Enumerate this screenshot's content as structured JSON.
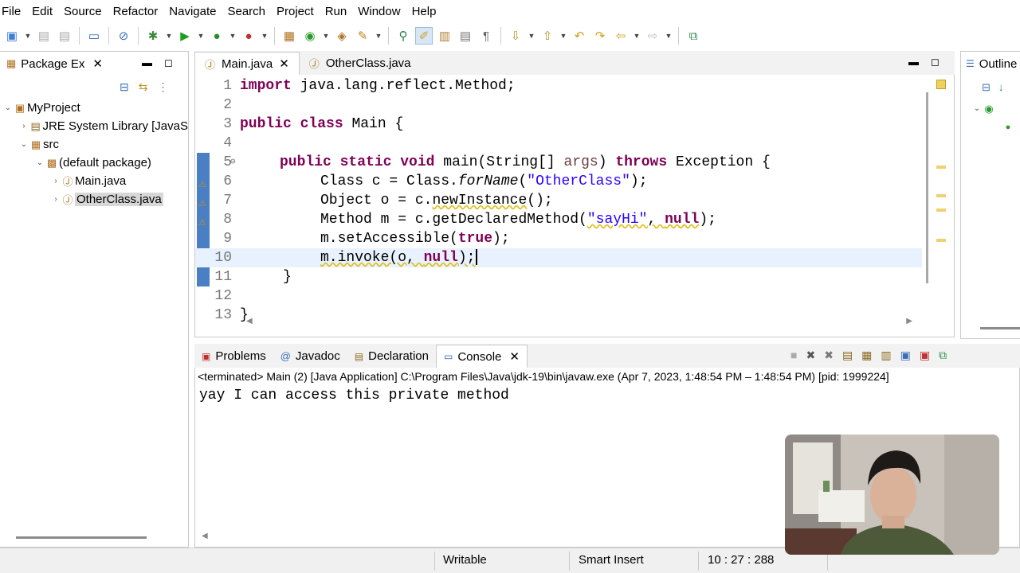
{
  "menu": [
    "File",
    "Edit",
    "Source",
    "Refactor",
    "Navigate",
    "Search",
    "Project",
    "Run",
    "Window",
    "Help"
  ],
  "package_explorer": {
    "title": "Package Ex",
    "tree": [
      {
        "label": "MyProject",
        "level": 0,
        "expanded": true,
        "icon": "project-icon"
      },
      {
        "label": "JRE System Library [JavaS",
        "level": 1,
        "expanded": false,
        "icon": "library-icon"
      },
      {
        "label": "src",
        "level": 1,
        "expanded": true,
        "icon": "source-folder-icon"
      },
      {
        "label": "(default package)",
        "level": 2,
        "expanded": true,
        "icon": "package-icon"
      },
      {
        "label": "Main.java",
        "level": 3,
        "expanded": false,
        "icon": "java-file-icon"
      },
      {
        "label": "OtherClass.java",
        "level": 3,
        "expanded": false,
        "icon": "java-file-icon",
        "selected": true
      }
    ]
  },
  "editor": {
    "tabs": [
      {
        "label": "Main.java",
        "active": true
      },
      {
        "label": "OtherClass.java",
        "active": false
      }
    ],
    "line_numbers": [
      "1",
      "2",
      "3",
      "4",
      "5",
      "6",
      "7",
      "8",
      "9",
      "10",
      "11",
      "12",
      "13"
    ],
    "code": {
      "l1_kw": "import",
      "l1_rest": " java.lang.reflect.Method;",
      "l3_kw1": "public",
      "l3_kw2": "class",
      "l3_rest": " Main {",
      "l5_kw1": "public",
      "l5_kw2": "static",
      "l5_kw3": "void",
      "l5_a": " main(String[] ",
      "l5_param": "args",
      "l5_b": ") ",
      "l5_kw4": "throws",
      "l5_c": " Exception {",
      "l6_a": "Class c = Class.",
      "l6_ital": "forName",
      "l6_b": "(",
      "l6_str": "\"OtherClass\"",
      "l6_c": ");",
      "l7_a": "Object o = c.",
      "l7_strike": "newInstance",
      "l7_b": "();",
      "l8_a": "Method m = c.getDeclaredMethod(",
      "l8_str": "\"sayHi\"",
      "l8_b": ", ",
      "l8_kw": "null",
      "l8_c": ");",
      "l9_a": "m.setAccessible(",
      "l9_kw": "true",
      "l9_b": ");",
      "l10_a": "m.invoke(o, ",
      "l10_kw": "null",
      "l10_b": ");",
      "l11": "}",
      "l13": "}"
    }
  },
  "outline": {
    "title": "Outline"
  },
  "console": {
    "tabs": [
      {
        "label": "Problems",
        "icon": "problems-icon",
        "active": false
      },
      {
        "label": "Javadoc",
        "icon": "javadoc-icon",
        "active": false
      },
      {
        "label": "Declaration",
        "icon": "declaration-icon",
        "active": false
      },
      {
        "label": "Console",
        "icon": "console-icon",
        "active": true
      }
    ],
    "terminated": "<terminated> Main (2) [Java Application] C:\\Program Files\\Java\\jdk-19\\bin\\javaw.exe  (Apr 7, 2023, 1:48:54 PM – 1:48:54 PM) [pid: 1999224]",
    "output": "yay I can access this private method"
  },
  "status": {
    "writable": "Writable",
    "insert_mode": "Smart Insert",
    "position": "10 : 27 : 288"
  }
}
